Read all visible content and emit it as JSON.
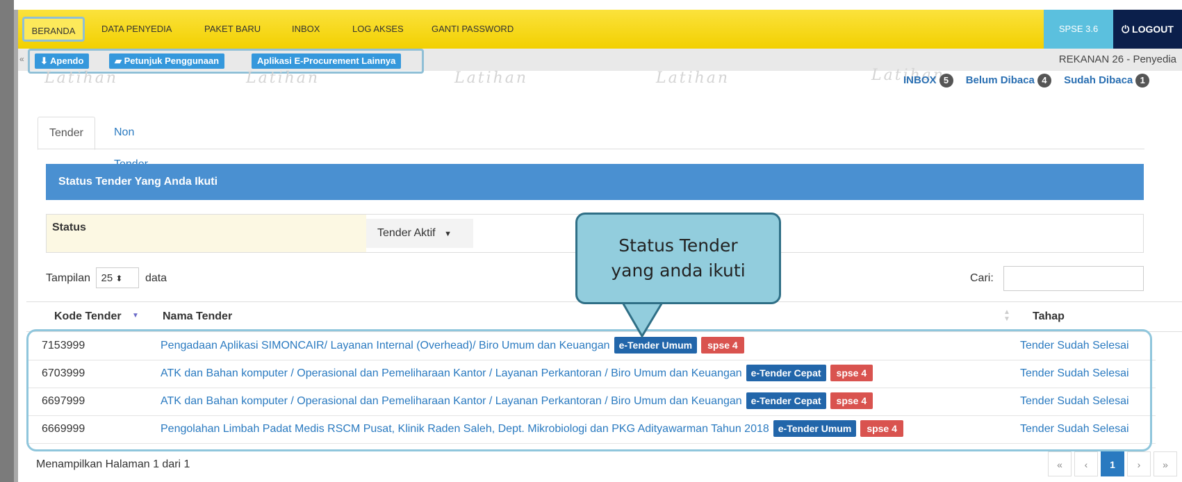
{
  "nav": {
    "items": [
      "BERANDA",
      "DATA PENYEDIA",
      "PAKET BARU",
      "INBOX",
      "LOG AKSES",
      "GANTI PASSWORD"
    ],
    "version": "SPSE 3.6",
    "logout": "LOGOUT"
  },
  "subbar": {
    "buttons": [
      "Apendo",
      "Petunjuk Penggunaan",
      "Aplikasi E-Procurement Lainnya"
    ],
    "user": "REKANAN 26 - Penyedia"
  },
  "watermark": "Latihan",
  "inbox": {
    "inbox_label": "INBOX",
    "inbox_count": "5",
    "unread_label": "Belum Dibaca",
    "unread_count": "4",
    "read_label": "Sudah Dibaca",
    "read_count": "1"
  },
  "tabs": [
    "Tender",
    "Non Tender"
  ],
  "panel": {
    "title": "Status Tender Yang Anda Ikuti",
    "status_label": "Status",
    "status_value": "Tender Aktif",
    "show_prefix": "Tampilan",
    "show_value": "25",
    "show_suffix": "data",
    "search_label": "Cari:",
    "search_value": ""
  },
  "table": {
    "headers": [
      "Kode Tender",
      "Nama Tender",
      "Tahap"
    ],
    "rows": [
      {
        "code": "7153999",
        "name": "Pengadaan Aplikasi SIMONCAIR/ Layanan Internal (Overhead)/ Biro Umum dan Keuangan",
        "type": "e-Tender Umum",
        "spse": "spse 4",
        "tahap": "Tender Sudah Selesai"
      },
      {
        "code": "6703999",
        "name": "ATK dan Bahan komputer / Operasional dan Pemeliharaan Kantor / Layanan Perkantoran / Biro Umum dan Keuangan",
        "type": "e-Tender Cepat",
        "spse": "spse 4",
        "tahap": "Tender Sudah Selesai"
      },
      {
        "code": "6697999",
        "name": "ATK dan Bahan komputer / Operasional dan Pemeliharaan Kantor / Layanan Perkantoran / Biro Umum dan Keuangan",
        "type": "e-Tender Cepat",
        "spse": "spse 4",
        "tahap": "Tender Sudah Selesai"
      },
      {
        "code": "6669999",
        "name": "Pengolahan Limbah Padat Medis RSCM Pusat, Klinik Raden Saleh, Dept. Mikrobiologi dan PKG Adityawarman Tahun 2018",
        "type": "e-Tender Umum",
        "spse": "spse 4",
        "tahap": "Tender Sudah Selesai"
      }
    ]
  },
  "footer": {
    "info": "Menampilkan Halaman 1 dari 1",
    "pager": [
      "«",
      "‹",
      "1",
      "›",
      "»"
    ]
  },
  "callout": {
    "line1": "Status Tender",
    "line2": "yang anda ikuti"
  },
  "colors": {
    "navbar": "#f2d000",
    "spse_button": "#5bc0de",
    "logout_button": "#0b1f4b",
    "panel_head": "#4a90d1",
    "label_blue": "#2266aa",
    "label_red": "#d9534f",
    "link": "#2a7ac0",
    "callout_fill": "#92cddd"
  }
}
